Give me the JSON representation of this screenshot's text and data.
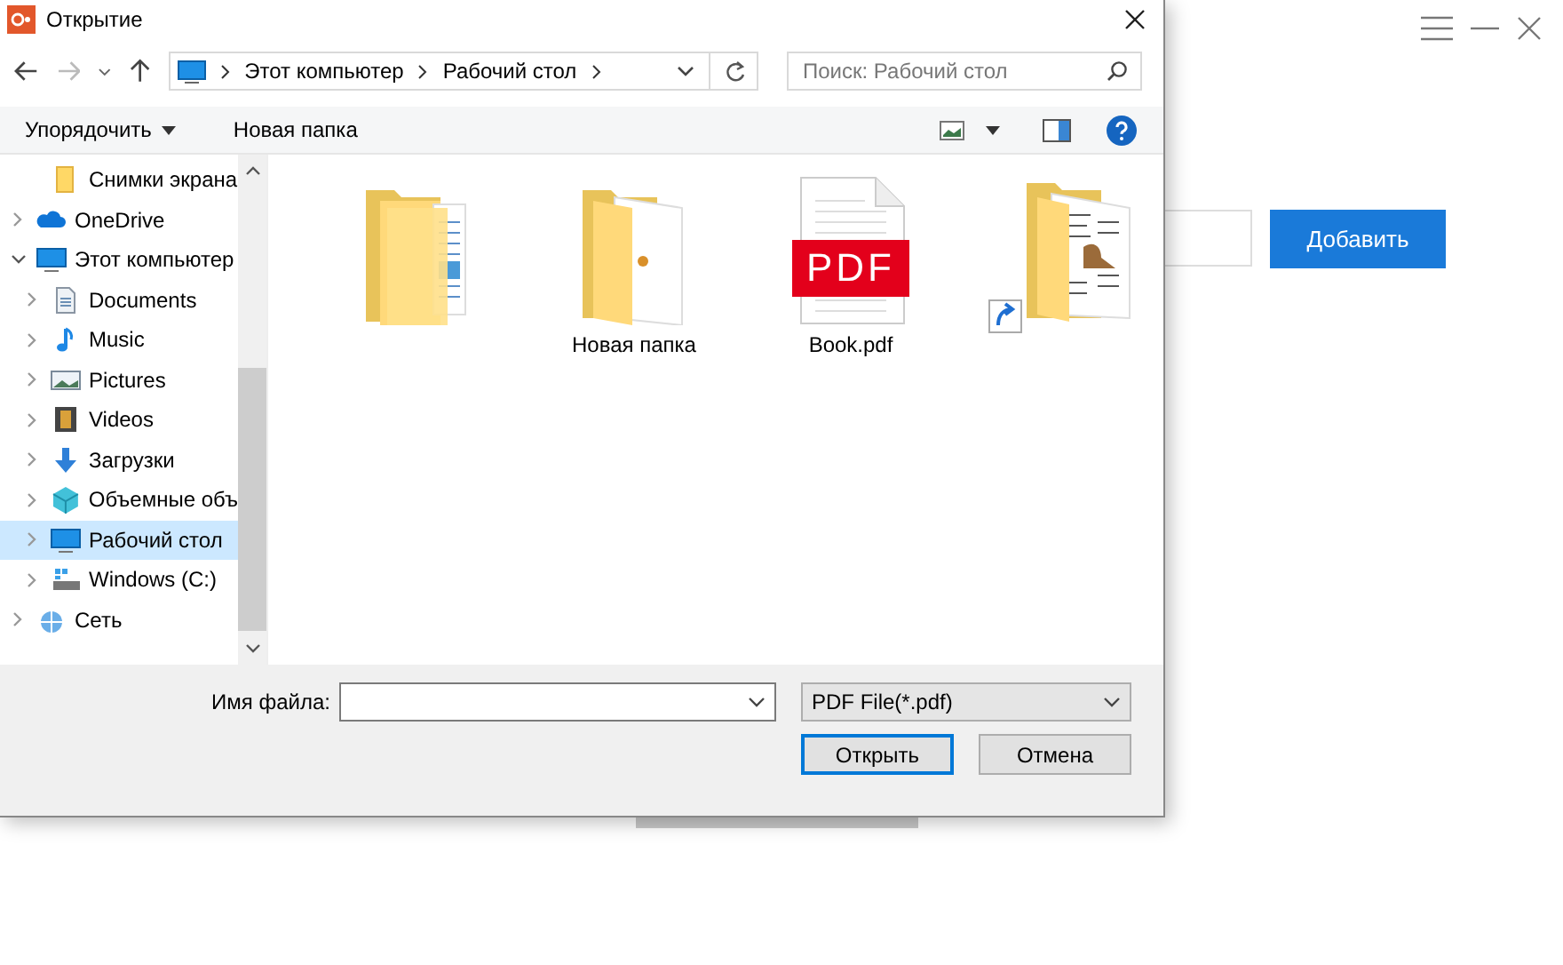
{
  "app": {
    "add_button": "Добавить"
  },
  "dialog": {
    "title": "Открытие",
    "address": {
      "segments": [
        "Этот компьютер",
        "Рабочий стол"
      ]
    },
    "search": {
      "placeholder": "Поиск: Рабочий стол"
    },
    "toolbar": {
      "organize": "Упорядочить",
      "new_folder": "Новая папка"
    },
    "tree": [
      {
        "children": [
          {
            "label": "Снимки экрана",
            "kind": "folder",
            "selected": false
          }
        ]
      },
      {
        "label": "OneDrive",
        "kind": "cloud",
        "expanded": false,
        "selected": false
      },
      {
        "label": "Этот компьютер",
        "kind": "computer",
        "expanded": true,
        "selected": false,
        "children": [
          {
            "label": "Documents",
            "kind": "document",
            "expanded": false,
            "selected": false
          },
          {
            "label": "Music",
            "kind": "music",
            "expanded": false,
            "selected": false
          },
          {
            "label": "Pictures",
            "kind": "pictures",
            "expanded": false,
            "selected": false
          },
          {
            "label": "Videos",
            "kind": "video",
            "expanded": false,
            "selected": false
          },
          {
            "label": "Загрузки",
            "kind": "download",
            "expanded": false,
            "selected": false
          },
          {
            "label": "Объемные объ",
            "kind": "cube",
            "expanded": false,
            "selected": false
          },
          {
            "label": "Рабочий стол",
            "kind": "desktop",
            "expanded": false,
            "selected": true
          },
          {
            "label": "Windows (C:)",
            "kind": "drive",
            "expanded": false,
            "selected": false
          }
        ]
      },
      {
        "label": "Сеть",
        "kind": "network",
        "expanded": false,
        "selected": false
      }
    ],
    "files": [
      {
        "kind": "folder-docs"
      },
      {
        "kind": "folder",
        "name": "Новая папка"
      },
      {
        "kind": "pdf",
        "name": "Book.pdf",
        "badge": "PDF"
      },
      {
        "kind": "shortcut-folder"
      }
    ],
    "filename": {
      "label": "Имя файла:"
    },
    "filter": "PDF File(*.pdf)",
    "buttons": [
      {
        "label": "Открыть",
        "default": true
      },
      {
        "label": "Отмена",
        "default": false
      }
    ]
  }
}
